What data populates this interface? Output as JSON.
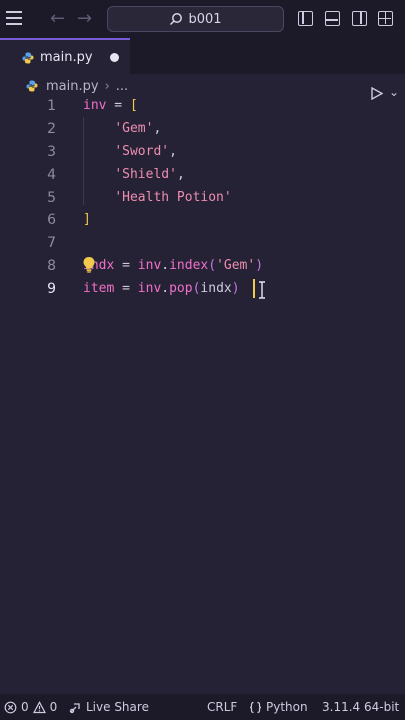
{
  "titlebar": {
    "search_text": "b001"
  },
  "tab": {
    "label": "main.py"
  },
  "breadcrumb": {
    "file": "main.py",
    "more": "..."
  },
  "editor": {
    "line_numbers": [
      "1",
      "2",
      "3",
      "4",
      "5",
      "6",
      "7",
      "8",
      "9"
    ],
    "lines": {
      "l1": {
        "var": "inv",
        "op": " = ",
        "open": "["
      },
      "l2": {
        "str": "'Gem'",
        "comma": ","
      },
      "l3": {
        "str": "'Sword'",
        "comma": ","
      },
      "l4": {
        "str": "'Shield'",
        "comma": ","
      },
      "l5": {
        "str": "'Health Potion'"
      },
      "l6": {
        "close": "]"
      },
      "l8": {
        "var": "indx",
        "op": " = ",
        "obj": "inv",
        "dot": ".",
        "fn": "index",
        "open": "(",
        "arg": "'Gem'",
        "close": ")"
      },
      "l9": {
        "var": "item",
        "op": " = ",
        "obj": "inv",
        "dot": ".",
        "fn": "pop",
        "open": "(",
        "arg": "indx",
        "close": ")"
      }
    }
  },
  "statusbar": {
    "errors": "0",
    "warnings": "0",
    "live_share": "Live Share",
    "eol": "CRLF",
    "language": "Python",
    "interpreter": "3.11.4 64-bit"
  },
  "colors": {
    "background": "#252235",
    "chrome": "#1c1a28",
    "variable": "#f070c8",
    "string": "#ed8db0",
    "bracket": "#f2c94c",
    "accent": "#7a5cd6"
  }
}
